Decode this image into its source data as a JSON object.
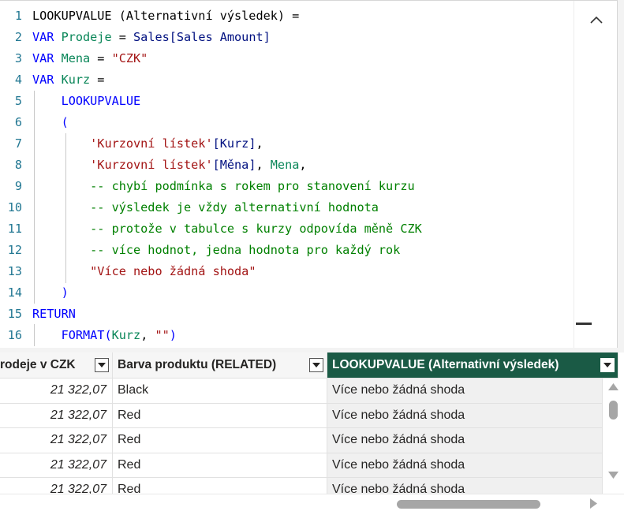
{
  "editor": {
    "lines": [
      {
        "n": "1",
        "parts": [
          {
            "t": "LOOKUPVALUE (Alternativní výsledek) = ",
            "c": ""
          }
        ]
      },
      {
        "n": "2",
        "parts": [
          {
            "t": "VAR ",
            "c": "k"
          },
          {
            "t": "Prodeje",
            "c": "v"
          },
          {
            "t": " = ",
            "c": ""
          },
          {
            "t": "Sales[Sales Amount]",
            "c": "tbl"
          }
        ]
      },
      {
        "n": "3",
        "parts": [
          {
            "t": "VAR ",
            "c": "k"
          },
          {
            "t": "Mena",
            "c": "v"
          },
          {
            "t": " = ",
            "c": ""
          },
          {
            "t": "\"CZK\"",
            "c": "s"
          }
        ]
      },
      {
        "n": "4",
        "parts": [
          {
            "t": "VAR ",
            "c": "k"
          },
          {
            "t": "Kurz",
            "c": "v"
          },
          {
            "t": " =",
            "c": ""
          }
        ]
      },
      {
        "n": "5",
        "parts": [
          {
            "t": "    ",
            "c": ""
          },
          {
            "t": "LOOKUPVALUE",
            "c": "k"
          }
        ]
      },
      {
        "n": "6",
        "parts": [
          {
            "t": "    (",
            "c": "k"
          }
        ]
      },
      {
        "n": "7",
        "parts": [
          {
            "t": "        ",
            "c": ""
          },
          {
            "t": "'Kurzovní lístek'",
            "c": "s"
          },
          {
            "t": "[Kurz]",
            "c": "tbl"
          },
          {
            "t": ",",
            "c": ""
          }
        ]
      },
      {
        "n": "8",
        "parts": [
          {
            "t": "        ",
            "c": ""
          },
          {
            "t": "'Kurzovní lístek'",
            "c": "s"
          },
          {
            "t": "[Měna]",
            "c": "tbl"
          },
          {
            "t": ", ",
            "c": ""
          },
          {
            "t": "Mena",
            "c": "v"
          },
          {
            "t": ",",
            "c": ""
          }
        ]
      },
      {
        "n": "9",
        "parts": [
          {
            "t": "        -- chybí podmínka s rokem pro stanovení kurzu",
            "c": "c"
          }
        ]
      },
      {
        "n": "10",
        "parts": [
          {
            "t": "        -- výsledek je vždy alternativní hodnota",
            "c": "c"
          }
        ]
      },
      {
        "n": "11",
        "parts": [
          {
            "t": "        -- protože v tabulce s kurzy odpovída měně CZK",
            "c": "c"
          }
        ]
      },
      {
        "n": "12",
        "parts": [
          {
            "t": "        -- více hodnot, jedna hodnota pro každý rok",
            "c": "c"
          }
        ]
      },
      {
        "n": "13",
        "parts": [
          {
            "t": "        ",
            "c": ""
          },
          {
            "t": "\"Více nebo žádná shoda\"",
            "c": "s"
          }
        ]
      },
      {
        "n": "14",
        "parts": [
          {
            "t": "    )",
            "c": "k"
          }
        ]
      },
      {
        "n": "15",
        "parts": [
          {
            "t": "RETURN",
            "c": "k"
          }
        ]
      },
      {
        "n": "16",
        "parts": [
          {
            "t": "    ",
            "c": ""
          },
          {
            "t": "FORMAT",
            "c": "k"
          },
          {
            "t": "(",
            "c": "k"
          },
          {
            "t": "Kurz",
            "c": "v"
          },
          {
            "t": ", ",
            "c": ""
          },
          {
            "t": "\"\"",
            "c": "s"
          },
          {
            "t": ")",
            "c": "k"
          }
        ]
      }
    ],
    "collapse_icon": "chevron-up-icon"
  },
  "table": {
    "columns": [
      {
        "label": "rodeje v CZK"
      },
      {
        "label": "Barva produktu (RELATED)"
      },
      {
        "label": "LOOKUPVALUE (Alternativní výsledek)"
      }
    ],
    "rows": [
      [
        "21 322,07",
        "Black",
        "Více nebo žádná shoda"
      ],
      [
        "21 322,07",
        "Red",
        "Více nebo žádná shoda"
      ],
      [
        "21 322,07",
        "Red",
        "Více nebo žádná shoda"
      ],
      [
        "21 322,07",
        "Red",
        "Více nebo žádná shoda"
      ],
      [
        "21 322,07",
        "Red",
        "Více nebo žádná shoda"
      ]
    ]
  },
  "colors": {
    "active_header": "#1a5a45",
    "keyword": "#0000ff",
    "variable": "#098658",
    "string": "#a31515",
    "comment": "#008000"
  }
}
